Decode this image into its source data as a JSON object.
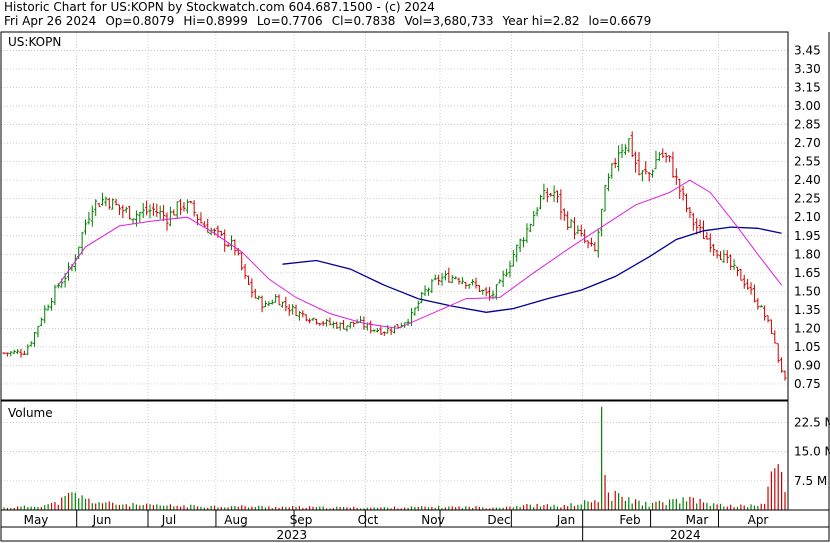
{
  "header": {
    "line1": "Historic Chart for US:KOPN by Stockwatch.com 604.687.1500 - (c) 2024",
    "line2": {
      "date": "Fri Apr 26 2024",
      "open": "Op=0.8079",
      "high": "Hi=0.8999",
      "low": "Lo=0.7706",
      "close": "Cl=0.7838",
      "volume": "Vol=3,680,733",
      "year_high": "Year hi=2.82",
      "year_low": "lo=0.6679"
    }
  },
  "chart_data": [
    {
      "type": "candlestick",
      "title": "US:KOPN",
      "ylim": [
        0.62,
        3.6
      ],
      "price_ticks": [
        "3.45",
        "3.30",
        "3.15",
        "3.00",
        "2.85",
        "2.70",
        "2.55",
        "2.40",
        "2.25",
        "2.10",
        "1.95",
        "1.80",
        "1.65",
        "1.50",
        "1.35",
        "1.20",
        "1.05",
        "0.90",
        "0.75"
      ],
      "months": [
        "May",
        "Jun",
        "Jul",
        "Aug",
        "Sep",
        "Oct",
        "Nov",
        "Dec",
        "Jan",
        "Feb",
        "Mar",
        "Apr"
      ],
      "years": [
        "2023",
        "2024"
      ],
      "grid": true,
      "colors": {
        "up": "#008000",
        "down": "#cc0000",
        "ma_short": "#e020e0",
        "ma_long": "#000099",
        "grid": "#b8b8b8",
        "frame": "#000000"
      },
      "price_anchors": [
        [
          0,
          1.0
        ],
        [
          6,
          1.01
        ],
        [
          8,
          1.1
        ],
        [
          12,
          1.35
        ],
        [
          16,
          1.55
        ],
        [
          20,
          1.7
        ],
        [
          22,
          1.88
        ],
        [
          24,
          2.05
        ],
        [
          26,
          2.2
        ],
        [
          30,
          2.25
        ],
        [
          34,
          2.17
        ],
        [
          38,
          2.12
        ],
        [
          44,
          2.16
        ],
        [
          48,
          2.1
        ],
        [
          52,
          2.2
        ],
        [
          55,
          2.18
        ],
        [
          58,
          2.06
        ],
        [
          62,
          1.97
        ],
        [
          68,
          1.85
        ],
        [
          71,
          1.6
        ],
        [
          74,
          1.45
        ],
        [
          77,
          1.38
        ],
        [
          80,
          1.45
        ],
        [
          83,
          1.38
        ],
        [
          87,
          1.32
        ],
        [
          91,
          1.28
        ],
        [
          95,
          1.24
        ],
        [
          100,
          1.22
        ],
        [
          104,
          1.25
        ],
        [
          108,
          1.2
        ],
        [
          112,
          1.18
        ],
        [
          116,
          1.22
        ],
        [
          120,
          1.3
        ],
        [
          124,
          1.5
        ],
        [
          128,
          1.6
        ],
        [
          133,
          1.62
        ],
        [
          137,
          1.57
        ],
        [
          140,
          1.52
        ],
        [
          143,
          1.45
        ],
        [
          146,
          1.55
        ],
        [
          150,
          1.8
        ],
        [
          154,
          2.0
        ],
        [
          158,
          2.25
        ],
        [
          162,
          2.3
        ],
        [
          165,
          2.1
        ],
        [
          168,
          2.0
        ],
        [
          171,
          1.9
        ],
        [
          174,
          1.82
        ],
        [
          177,
          2.3
        ],
        [
          181,
          2.65
        ],
        [
          184,
          2.72
        ],
        [
          187,
          2.45
        ],
        [
          190,
          2.45
        ],
        [
          193,
          2.62
        ],
        [
          196,
          2.55
        ],
        [
          199,
          2.32
        ],
        [
          202,
          2.1
        ],
        [
          205,
          1.98
        ],
        [
          208,
          1.9
        ],
        [
          211,
          1.8
        ],
        [
          214,
          1.7
        ],
        [
          218,
          1.58
        ],
        [
          221,
          1.45
        ],
        [
          224,
          1.3
        ],
        [
          226,
          1.18
        ],
        [
          228,
          0.95
        ],
        [
          230,
          0.78
        ]
      ],
      "ma_short": [
        [
          16,
          1.55
        ],
        [
          24,
          1.86
        ],
        [
          34,
          2.03
        ],
        [
          44,
          2.07
        ],
        [
          54,
          2.1
        ],
        [
          62,
          1.97
        ],
        [
          70,
          1.82
        ],
        [
          78,
          1.6
        ],
        [
          86,
          1.45
        ],
        [
          96,
          1.32
        ],
        [
          106,
          1.24
        ],
        [
          116,
          1.2
        ],
        [
          126,
          1.32
        ],
        [
          136,
          1.44
        ],
        [
          146,
          1.45
        ],
        [
          156,
          1.65
        ],
        [
          166,
          1.84
        ],
        [
          176,
          2.02
        ],
        [
          186,
          2.2
        ],
        [
          196,
          2.3
        ],
        [
          202,
          2.4
        ],
        [
          208,
          2.3
        ],
        [
          216,
          2.02
        ],
        [
          222,
          1.8
        ],
        [
          229,
          1.55
        ]
      ],
      "ma_long": [
        [
          82,
          1.72
        ],
        [
          92,
          1.75
        ],
        [
          102,
          1.68
        ],
        [
          112,
          1.55
        ],
        [
          122,
          1.44
        ],
        [
          132,
          1.38
        ],
        [
          142,
          1.33
        ],
        [
          150,
          1.36
        ],
        [
          160,
          1.44
        ],
        [
          170,
          1.51
        ],
        [
          180,
          1.62
        ],
        [
          190,
          1.78
        ],
        [
          198,
          1.92
        ],
        [
          206,
          1.99
        ],
        [
          214,
          2.02
        ],
        [
          222,
          2.01
        ],
        [
          229,
          1.97
        ]
      ]
    },
    {
      "type": "bar",
      "title": "Volume",
      "ylim": [
        0,
        28
      ],
      "ticks": [
        "22.5 M",
        "15.0 M",
        "7.5 M"
      ],
      "anchors": [
        [
          0,
          0.6
        ],
        [
          8,
          0.9
        ],
        [
          15,
          1.6
        ],
        [
          19,
          3.4
        ],
        [
          21,
          4.1
        ],
        [
          24,
          2.6
        ],
        [
          30,
          1.7
        ],
        [
          40,
          1.2
        ],
        [
          55,
          1.0
        ],
        [
          70,
          0.9
        ],
        [
          90,
          0.7
        ],
        [
          110,
          0.6
        ],
        [
          120,
          0.7
        ],
        [
          130,
          0.8
        ],
        [
          145,
          0.7
        ],
        [
          155,
          1.2
        ],
        [
          165,
          1.0
        ],
        [
          174,
          2.3
        ],
        [
          176,
          1.4
        ],
        [
          180,
          3.6
        ],
        [
          185,
          2.4
        ],
        [
          190,
          1.4
        ],
        [
          200,
          2.6
        ],
        [
          205,
          2.2
        ],
        [
          210,
          1.2
        ],
        [
          218,
          1.0
        ],
        [
          224,
          1.5
        ],
        [
          226,
          8.0
        ],
        [
          228,
          13.5
        ],
        [
          230,
          4.5
        ]
      ],
      "spikes": [
        [
          176,
          26.5
        ],
        [
          177,
          9.0
        ],
        [
          178,
          4.5
        ]
      ]
    }
  ]
}
